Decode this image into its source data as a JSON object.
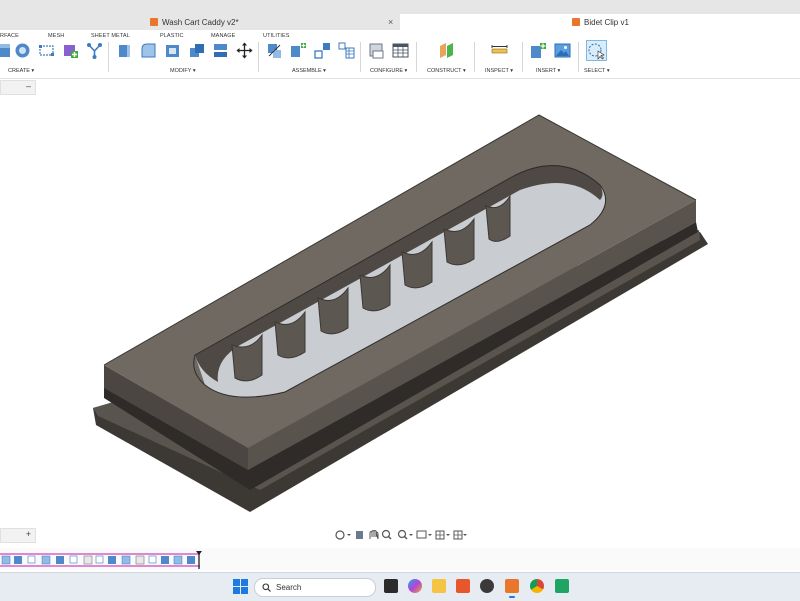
{
  "tabs": [
    {
      "title": "Wash Cart Caddy v2*",
      "close": "×",
      "active": false
    },
    {
      "title": "Bidet Clip v1",
      "close": "",
      "active": true
    }
  ],
  "ribbon": {
    "categories": [
      "RFACE",
      "MESH",
      "SHEET METAL",
      "PLASTIC",
      "MANAGE",
      "UTILITIES"
    ],
    "groups": [
      "CREATE ▾",
      "MODIFY ▾",
      "ASSEMBLE ▾",
      "CONFIGURE ▾",
      "CONSTRUCT ▾",
      "INSPECT ▾",
      "INSERT ▾",
      "SELECT ▾"
    ]
  },
  "panel": {
    "collapse_symbol": "–",
    "add_symbol": "+"
  },
  "taskbar": {
    "search_placeholder": "Search"
  },
  "colors": {
    "part_top": "#6f6962",
    "part_side": "#59534d",
    "part_dark": "#3c3833",
    "accent_orange": "#e8762c",
    "timeline_pink": "#d65fc8"
  }
}
